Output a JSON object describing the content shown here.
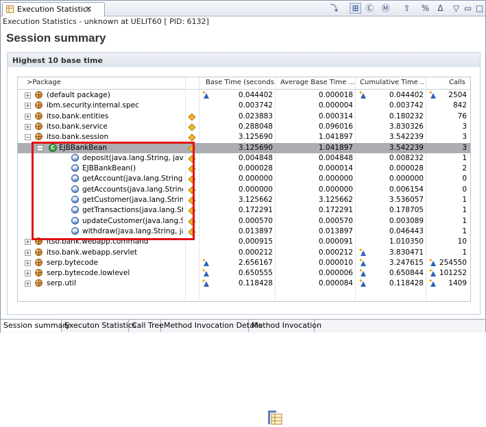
{
  "view": {
    "tab_title": "Execution Statistics",
    "close_glyph": "✕",
    "status_line": "Execution Statistics - unknown at UELIT60 [ PID: 6132]",
    "page_title": "Session summary",
    "section_title": "Highest 10 base time"
  },
  "toolbar": [
    {
      "icon": "export-icon",
      "glyph": "⤵",
      "pressed": false
    },
    {
      "icon": "package-view-icon",
      "glyph": "⊞",
      "pressed": true
    },
    {
      "icon": "class-view-icon",
      "glyph": "Ⓒ",
      "pressed": false
    },
    {
      "icon": "method-view-icon",
      "glyph": "Ⓜ",
      "pressed": false
    },
    {
      "icon": "open-source-icon",
      "glyph": "⇧",
      "pressed": false
    },
    {
      "icon": "percent-icon",
      "glyph": "%",
      "pressed": false
    },
    {
      "icon": "delta-icon",
      "glyph": "Δ",
      "pressed": false
    },
    {
      "icon": "view-menu-icon",
      "glyph": "▽",
      "pressed": false
    },
    {
      "icon": "minimize-icon",
      "glyph": "▭",
      "pressed": false
    },
    {
      "icon": "maximize-icon",
      "glyph": "□",
      "pressed": false
    }
  ],
  "columns": {
    "package": ">Package",
    "base_time": "Base Time (seconds)",
    "avg_base_time": "Average Base Time ...",
    "cumulative_time": "Cumulative Time ...",
    "calls": "Calls"
  },
  "rows": [
    {
      "level": 0,
      "type": "package",
      "expander": "+",
      "name": "(default package)",
      "marker": "",
      "base_delta": true,
      "base": "0.044402",
      "avg": "0.000018",
      "cum_delta": true,
      "cum": "0.044402",
      "calls_delta": true,
      "calls": "2504"
    },
    {
      "level": 0,
      "type": "package",
      "expander": "+",
      "name": "ibm.security.internal.spec",
      "marker": "",
      "base_delta": false,
      "base": "0.003742",
      "avg": "0.000004",
      "cum_delta": false,
      "cum": "0.003742",
      "calls_delta": false,
      "calls": "842"
    },
    {
      "level": 0,
      "type": "package",
      "expander": "+",
      "name": "itso.bank.entities",
      "marker": "diamond",
      "base_delta": false,
      "base": "0.023883",
      "avg": "0.000314",
      "cum_delta": false,
      "cum": "0.180232",
      "calls_delta": false,
      "calls": "76"
    },
    {
      "level": 0,
      "type": "package",
      "expander": "+",
      "name": "itso.bank.service",
      "marker": "diamond",
      "base_delta": false,
      "base": "0.288048",
      "avg": "0.096016",
      "cum_delta": false,
      "cum": "3.830326",
      "calls_delta": false,
      "calls": "3"
    },
    {
      "level": 0,
      "type": "package",
      "expander": "−",
      "name": "itso.bank.session",
      "marker": "diamond",
      "base_delta": false,
      "base": "3.125690",
      "avg": "1.041897",
      "cum_delta": false,
      "cum": "3.542239",
      "calls_delta": false,
      "calls": "3"
    },
    {
      "level": 1,
      "type": "class",
      "expander": "−",
      "name": "EJBBankBean",
      "marker": "diamond",
      "base_delta": false,
      "base": "3.125690",
      "avg": "1.041897",
      "cum_delta": false,
      "cum": "3.542239",
      "calls_delta": false,
      "calls": "3",
      "selected": true
    },
    {
      "level": 2,
      "type": "method",
      "expander": "",
      "name": "deposit(java.lang.String, java.math",
      "marker": "diamond",
      "base_delta": false,
      "base": "0.004848",
      "avg": "0.004848",
      "cum_delta": false,
      "cum": "0.008232",
      "calls_delta": false,
      "calls": "1"
    },
    {
      "level": 2,
      "type": "method",
      "expander": "",
      "name": "EJBBankBean()",
      "marker": "diamond",
      "base_delta": false,
      "base": "0.000028",
      "avg": "0.000014",
      "cum_delta": false,
      "cum": "0.000028",
      "calls_delta": false,
      "calls": "2"
    },
    {
      "level": 2,
      "type": "method",
      "expander": "",
      "name": "getAccount(java.lang.String) itso.ba",
      "marker": "diamond",
      "base_delta": false,
      "base": "0.000000",
      "avg": "0.000000",
      "cum_delta": false,
      "cum": "0.000000",
      "calls_delta": false,
      "calls": "0"
    },
    {
      "level": 2,
      "type": "method",
      "expander": "",
      "name": "getAccounts(java.lang.String) itso.ba",
      "marker": "diamond",
      "base_delta": false,
      "base": "0.000000",
      "avg": "0.000000",
      "cum_delta": false,
      "cum": "0.006154",
      "calls_delta": false,
      "calls": "0"
    },
    {
      "level": 2,
      "type": "method",
      "expander": "",
      "name": "getCustomer(java.lang.String) itso.b",
      "marker": "diamond",
      "base_delta": false,
      "base": "3.125662",
      "avg": "3.125662",
      "cum_delta": false,
      "cum": "3.536057",
      "calls_delta": false,
      "calls": "1"
    },
    {
      "level": 2,
      "type": "method",
      "expander": "",
      "name": "getTransactions(java.lang.String) it",
      "marker": "diamond",
      "base_delta": false,
      "base": "0.172291",
      "avg": "0.172291",
      "cum_delta": false,
      "cum": "0.178705",
      "calls_delta": false,
      "calls": "1"
    },
    {
      "level": 2,
      "type": "method",
      "expander": "",
      "name": "updateCustomer(java.lang.String, j",
      "marker": "diamond",
      "base_delta": false,
      "base": "0.000570",
      "avg": "0.000570",
      "cum_delta": false,
      "cum": "0.003089",
      "calls_delta": false,
      "calls": "1"
    },
    {
      "level": 2,
      "type": "method",
      "expander": "",
      "name": "withdraw(java.lang.String, java.ma",
      "marker": "diamond",
      "base_delta": false,
      "base": "0.013897",
      "avg": "0.013897",
      "cum_delta": false,
      "cum": "0.046443",
      "calls_delta": false,
      "calls": "1"
    },
    {
      "level": 0,
      "type": "package",
      "expander": "+",
      "name": "itso.bank.webapp.command",
      "marker": "",
      "base_delta": false,
      "base": "0.000915",
      "avg": "0.000091",
      "cum_delta": false,
      "cum": "1.010350",
      "calls_delta": false,
      "calls": "10"
    },
    {
      "level": 0,
      "type": "package",
      "expander": "+",
      "name": "itso.bank.webapp.servlet",
      "marker": "",
      "base_delta": false,
      "base": "0.000212",
      "avg": "0.000212",
      "cum_delta": true,
      "cum": "3.830471",
      "calls_delta": false,
      "calls": "1"
    },
    {
      "level": 0,
      "type": "package",
      "expander": "+",
      "name": "serp.bytecode",
      "marker": "",
      "base_delta": true,
      "base": "2.656167",
      "avg": "0.000010",
      "cum_delta": true,
      "cum": "3.247615",
      "calls_delta": true,
      "calls": "254550"
    },
    {
      "level": 0,
      "type": "package",
      "expander": "+",
      "name": "serp.bytecode.lowlevel",
      "marker": "",
      "base_delta": true,
      "base": "0.650555",
      "avg": "0.000006",
      "cum_delta": true,
      "cum": "0.650844",
      "calls_delta": true,
      "calls": "101252"
    },
    {
      "level": 0,
      "type": "package",
      "expander": "+",
      "name": "serp.util",
      "marker": "",
      "base_delta": true,
      "base": "0.118428",
      "avg": "0.000084",
      "cum_delta": true,
      "cum": "0.118428",
      "calls_delta": true,
      "calls": "1409"
    }
  ],
  "bottom_tabs": [
    {
      "label": "Session summary",
      "active": true
    },
    {
      "label": "Executon Statistics",
      "active": false
    },
    {
      "label": "Call Tree",
      "active": false
    },
    {
      "label": "Method Invocation Details",
      "active": false
    },
    {
      "label": "Method Invocation",
      "active": false
    }
  ],
  "colors": {
    "highlight_box": "#e01010",
    "selected_row": "#adadb3"
  }
}
